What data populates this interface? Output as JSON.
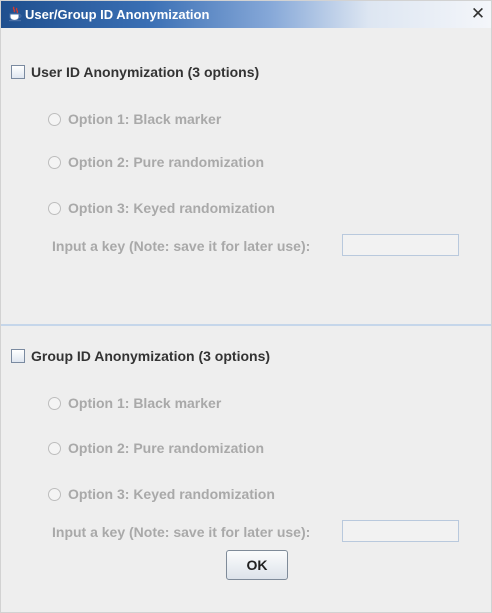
{
  "window": {
    "title": "User/Group ID Anonymization",
    "close_glyph": "✕",
    "icon": "java-cup-icon"
  },
  "user_section": {
    "checkbox_label": "User ID Anonymization (3 options)",
    "checked": false,
    "options": [
      "Option 1: Black marker",
      "Option 2: Pure randomization",
      "Option 3: Keyed randomization"
    ],
    "key_label": "Input a key (Note: save it for later use):",
    "key_value": ""
  },
  "group_section": {
    "checkbox_label": "Group ID Anonymization (3 options)",
    "checked": false,
    "options": [
      "Option 1: Black marker",
      "Option 2: Pure randomization",
      "Option 3: Keyed randomization"
    ],
    "key_label": "Input a key (Note: save it for later use):",
    "key_value": ""
  },
  "ok_label": "OK"
}
